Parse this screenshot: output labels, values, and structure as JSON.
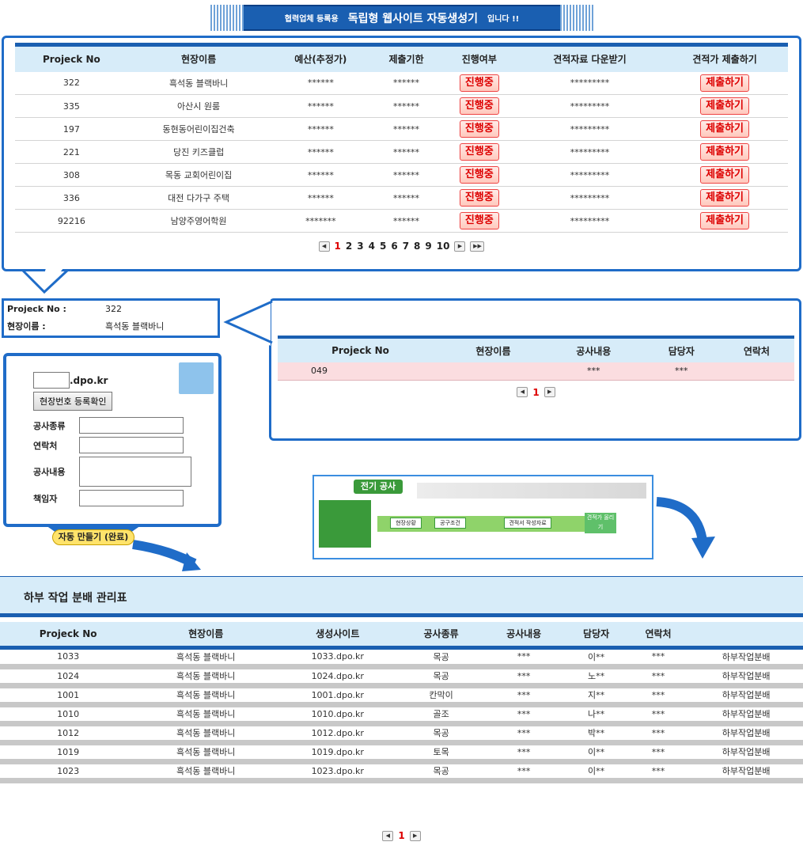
{
  "banner": {
    "prefix": "협력업체 등록용",
    "title": "독립형 웹사이트 자동생성기",
    "suffix": "입니다 !!"
  },
  "project_table": {
    "headers": [
      "Projeck No",
      "현장이름",
      "예산(추정가)",
      "제출기한",
      "진행여부",
      "견적자료 다운받기",
      "견적가 제출하기"
    ],
    "rows": [
      {
        "no": "322",
        "name": "흑석동 블랙바니",
        "budget": "******",
        "deadline": "******",
        "status": "진행중",
        "download": "*********",
        "submit": "제출하기"
      },
      {
        "no": "335",
        "name": "아산시 원룸",
        "budget": "******",
        "deadline": "******",
        "status": "진행중",
        "download": "*********",
        "submit": "제출하기"
      },
      {
        "no": "197",
        "name": "동현동어린이집건축",
        "budget": "******",
        "deadline": "******",
        "status": "진행중",
        "download": "*********",
        "submit": "제출하기"
      },
      {
        "no": "221",
        "name": "당진 키즈클럽",
        "budget": "******",
        "deadline": "******",
        "status": "진행중",
        "download": "*********",
        "submit": "제출하기"
      },
      {
        "no": "308",
        "name": "목동 교회어린이집",
        "budget": "******",
        "deadline": "******",
        "status": "진행중",
        "download": "*********",
        "submit": "제출하기"
      },
      {
        "no": "336",
        "name": "대전 다가구 주택",
        "budget": "******",
        "deadline": "******",
        "status": "진행중",
        "download": "*********",
        "submit": "제출하기"
      },
      {
        "no": "92216",
        "name": "남양주영어학원",
        "budget": "*******",
        "deadline": "******",
        "status": "진행중",
        "download": "*********",
        "submit": "제출하기"
      }
    ],
    "pages": [
      "1",
      "2",
      "3",
      "4",
      "5",
      "6",
      "7",
      "8",
      "9",
      "10"
    ],
    "current_page": "1"
  },
  "info_box": {
    "no_label": "Projeck No :",
    "no_value": "322",
    "name_label": "현장이름 :",
    "name_value": "흑석동 블랙바니"
  },
  "sub_table": {
    "headers": [
      "Projeck No",
      "현장이름",
      "공사내용",
      "담당자",
      "연락처"
    ],
    "row": {
      "no": "049",
      "name": "",
      "content": "***",
      "manager": "***",
      "contact": ""
    },
    "current_page": "1"
  },
  "form": {
    "domain_suffix": ".dpo.kr",
    "reg_button": "현장번호 등록확인",
    "type_label": "공사종류",
    "contact_label": "연락처",
    "content_label": "공사내용",
    "manager_label": "책임자",
    "auto_button": "자동 만들기 (완료)"
  },
  "thumbnail": {
    "title": "전기 공사",
    "steps": [
      "현장상황",
      "공구조건",
      "견적서 작성자료",
      "견적가 올리기"
    ]
  },
  "bottom": {
    "title": "하부 작업 분배 관리표",
    "headers": [
      "Projeck No",
      "현장이름",
      "생성사이트",
      "공사종류",
      "공사내용",
      "담당자",
      "연락처",
      ""
    ],
    "rows": [
      {
        "no": "1033",
        "name": "흑석동 블랙바니",
        "site": "1033.dpo.kr",
        "type": "목공",
        "content": "***",
        "manager": "이**",
        "contact": "***",
        "action": "하부작업분배"
      },
      {
        "no": "1024",
        "name": "흑석동 블랙바니",
        "site": "1024.dpo.kr",
        "type": "목공",
        "content": "***",
        "manager": "노**",
        "contact": "***",
        "action": "하부작업분배"
      },
      {
        "no": "1001",
        "name": "흑석동 블랙바니",
        "site": "1001.dpo.kr",
        "type": "칸막이",
        "content": "***",
        "manager": "지**",
        "contact": "***",
        "action": "하부작업분배"
      },
      {
        "no": "1010",
        "name": "흑석동 블랙바니",
        "site": "1010.dpo.kr",
        "type": "골조",
        "content": "***",
        "manager": "나**",
        "contact": "***",
        "action": "하부작업분배"
      },
      {
        "no": "1012",
        "name": "흑석동 블랙바니",
        "site": "1012.dpo.kr",
        "type": "목공",
        "content": "***",
        "manager": "박**",
        "contact": "***",
        "action": "하부작업분배"
      },
      {
        "no": "1019",
        "name": "흑석동 블랙바니",
        "site": "1019.dpo.kr",
        "type": "토목",
        "content": "***",
        "manager": "이**",
        "contact": "***",
        "action": "하부작업분배"
      },
      {
        "no": "1023",
        "name": "흑석동 블랙바니",
        "site": "1023.dpo.kr",
        "type": "목공",
        "content": "***",
        "manager": "이**",
        "contact": "***",
        "action": "하부작업분배"
      }
    ],
    "current_page": "1"
  },
  "colors": {
    "primary_blue": "#1a5fb1",
    "header_bg": "#d7ecf9",
    "status_red": "#dd0000",
    "highlight_row": "#fbdde0"
  }
}
